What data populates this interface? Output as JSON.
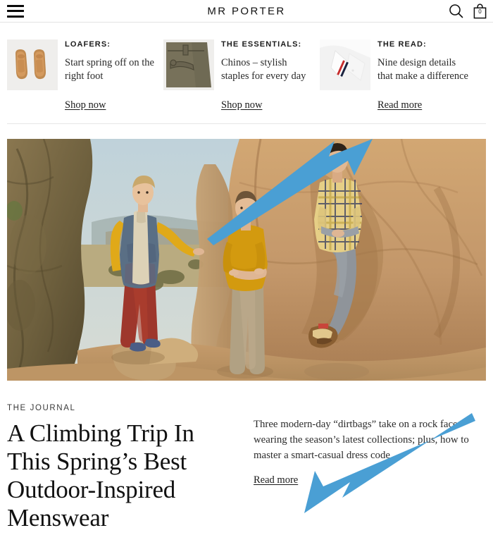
{
  "header": {
    "brand": "MR PORTER",
    "menu_icon": "hamburger-menu-icon",
    "search_icon": "search-icon",
    "bag_icon": "shopping-bag-icon",
    "bag_count": "0"
  },
  "promos": [
    {
      "kicker": "LOAFERS:",
      "desc": "Start spring off on the right foot",
      "link": "Shop now",
      "thumb_name": "loafers-thumbnail"
    },
    {
      "kicker": "THE ESSENTIALS:",
      "desc": "Chinos – stylish staples for every day",
      "link": "Shop now",
      "thumb_name": "chinos-thumbnail"
    },
    {
      "kicker": "THE READ:",
      "desc": "Nine design details that make a difference",
      "link": "Read more",
      "thumb_name": "shirt-collar-thumbnail"
    }
  ],
  "hero": {
    "alt": "Three men in outdoor-inspired menswear posing on desert rock formations"
  },
  "journal": {
    "eyebrow": "THE JOURNAL",
    "title": "A Climbing Trip In This Spring’s Best Outdoor-Inspired Menswear",
    "standfirst": "Three modern-day “dirtbags” take on a rock face wearing the season’s latest collections; plus, how to master a smart-casual dress code",
    "link": "Read more"
  },
  "annotations": {
    "arrow_color": "#4a9fd4",
    "arrow_1_target": "the-read-read-more-link",
    "arrow_2_target": "journal-read-more-link"
  },
  "colors": {
    "text": "#111111",
    "divider": "#e6e6e6",
    "accent_blue": "#4a9fd4"
  }
}
